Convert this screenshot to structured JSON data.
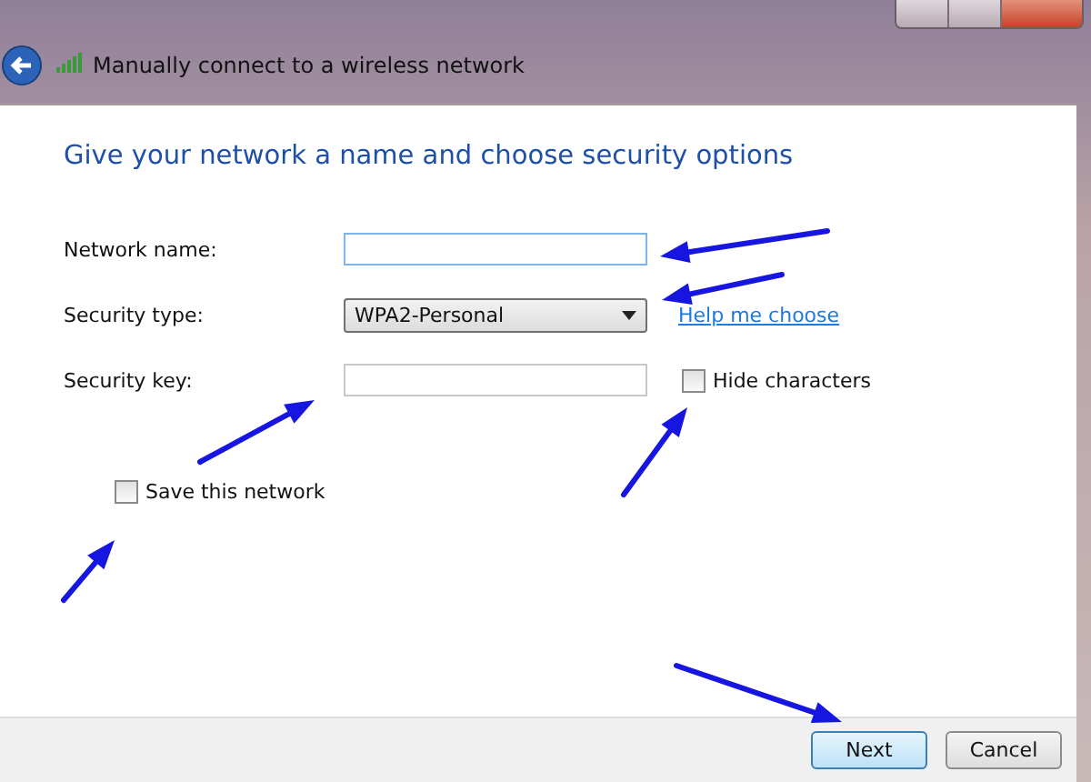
{
  "window": {
    "title": "Manually connect to a wireless network"
  },
  "heading": "Give your network a name and choose security options",
  "fields": [
    {
      "kind": "text",
      "label": "Network name:",
      "focused": true
    },
    {
      "kind": "select",
      "label": "Security type:",
      "value": "WPA2-Personal",
      "link": "Help me choose"
    },
    {
      "kind": "text",
      "label": "Security key:",
      "focused": false,
      "checkbox": {
        "label": "Hide characters",
        "checked": false
      }
    }
  ],
  "save_network": {
    "label": "Save this network",
    "checked": false
  },
  "buttons": [
    {
      "label": "Next",
      "default": true
    },
    {
      "label": "Cancel",
      "default": false
    }
  ]
}
